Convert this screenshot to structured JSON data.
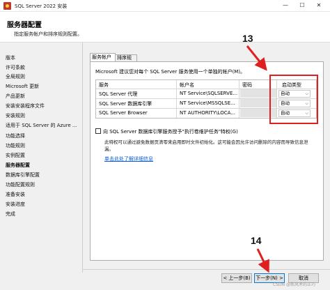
{
  "window": {
    "title": "SQL Server 2022 安装",
    "minimize": "—",
    "maximize": "☐",
    "close": "✕"
  },
  "header": {
    "title": "服务器配置",
    "subtitle": "指定服务帐户和排序规则配置。"
  },
  "sidebar": {
    "items": [
      {
        "label": "版本",
        "active": false
      },
      {
        "label": "许可条款",
        "active": false
      },
      {
        "label": "全局规则",
        "active": false
      },
      {
        "label": "Microsoft 更新",
        "active": false
      },
      {
        "label": "产品更新",
        "active": false
      },
      {
        "label": "安装安装程序文件",
        "active": false
      },
      {
        "label": "安装规则",
        "active": false
      },
      {
        "label": "适用于 SQL Server 的 Azure ...",
        "active": false
      },
      {
        "label": "功能选择",
        "active": false
      },
      {
        "label": "功能规则",
        "active": false
      },
      {
        "label": "实例配置",
        "active": false
      },
      {
        "label": "服务器配置",
        "active": true
      },
      {
        "label": "数据库引擎配置",
        "active": false
      },
      {
        "label": "功能配置规则",
        "active": false
      },
      {
        "label": "准备安装",
        "active": false
      },
      {
        "label": "安装进度",
        "active": false
      },
      {
        "label": "完成",
        "active": false
      }
    ]
  },
  "tabs": {
    "accounts": "服务帐户",
    "collation": "排序规则"
  },
  "recommend_text": "Microsoft 建议您对每个 SQL Server 服务使用一个单独的帐户(M)。",
  "grid": {
    "headers": {
      "service": "服务",
      "account": "帐户名",
      "password": "密码",
      "startup": "启动类型"
    },
    "rows": [
      {
        "service": "SQL Server 代理",
        "account": "NT Service\\SQLSERVE...",
        "startup": "自动"
      },
      {
        "service": "SQL Server 数据库引擎",
        "account": "NT Service\\MSSQLSE...",
        "startup": "自动"
      },
      {
        "service": "SQL Server Browser",
        "account": "NT AUTHORITY\\LOCA...",
        "startup": "自动"
      }
    ]
  },
  "checkbox": {
    "label": "向 SQL Server 数据库引擎服务授予\"执行卷维护任务\"特权(G)",
    "checked": false
  },
  "description": "此特权可以通过避免数据页清零来启用即时文件初始化。这可能会因允许访问删除的内容而导致信息泄漏。",
  "link": "单击此处了解详细信息",
  "buttons": {
    "back": "< 上一步(B)",
    "next": "下一步(N) >",
    "cancel": "取消"
  },
  "watermark": "CSDN @炼风术的正巧",
  "annotations": {
    "label_13": "13",
    "label_14": "14",
    "highlight_color": "#e02020"
  }
}
